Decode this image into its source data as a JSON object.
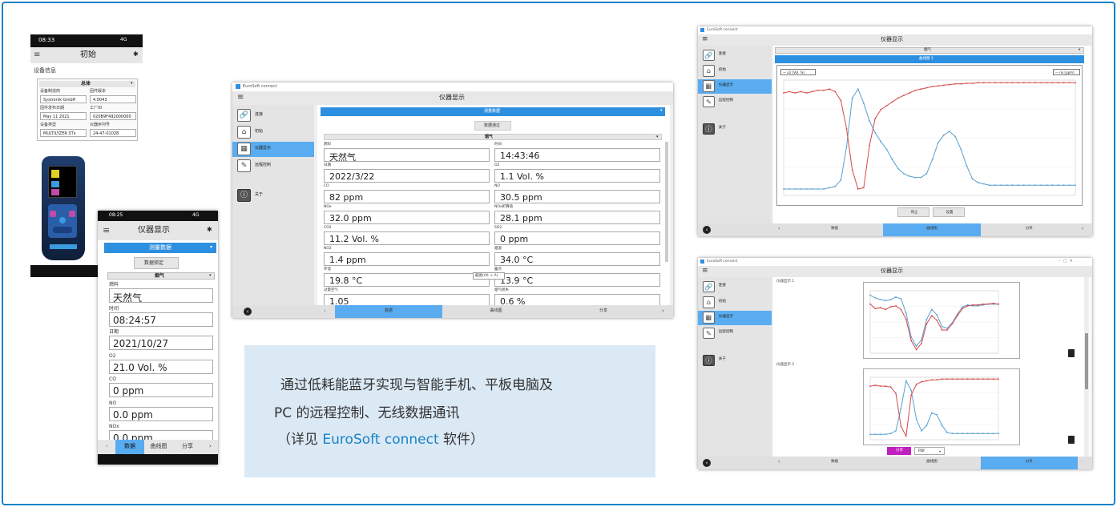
{
  "phone1": {
    "status_time": "08:33",
    "status_right": "4G",
    "title": "初始",
    "section": "设备信息",
    "group": "总体",
    "fields": [
      {
        "label": "设备制造商",
        "value": "Systronik GmbH"
      },
      {
        "label": "固件版本",
        "value": "4.0043"
      },
      {
        "label": "固件发布日期",
        "value": "May 11 2021"
      },
      {
        "label": "工厂ID",
        "value": "020B9F492000000"
      },
      {
        "label": "设备类型",
        "value": "MULTILYZER STx"
      },
      {
        "label": "仪器序列号",
        "value": "24-47-01028"
      }
    ]
  },
  "phone2": {
    "status_time": "08:25",
    "status_right": "4G",
    "title": "仪器显示",
    "subheader": "测量数据",
    "lock_button": "数据锁定",
    "group": "烟气",
    "fields": [
      {
        "label": "燃料",
        "value": "天然气"
      },
      {
        "label": "时间",
        "value": "08:24:57"
      },
      {
        "label": "日期",
        "value": "2021/10/27"
      },
      {
        "label": "O2",
        "value": "21.0 Vol. %"
      },
      {
        "label": "CO",
        "value": "0 ppm"
      },
      {
        "label": "NO",
        "value": "0.0 ppm"
      },
      {
        "label": "NOx",
        "value": "0.0 ppm"
      }
    ],
    "tabs": [
      "数据",
      "曲线图",
      "分享"
    ],
    "active_tab": 0
  },
  "win1": {
    "app": "EuroSoft connect",
    "title": "仪器显示",
    "sidebar": [
      "连接",
      "初始",
      "仪器显示",
      "远程控制",
      "关于"
    ],
    "subheader": "测量数据",
    "button": "数据通过",
    "group": "烟气",
    "fields": [
      {
        "label": "燃料",
        "value": "天然气"
      },
      {
        "label": "时间",
        "value": "14:43:46"
      },
      {
        "label": "日期",
        "value": "2022/3/22"
      },
      {
        "label": "O2",
        "value": "1.1 Vol. %"
      },
      {
        "label": "CO",
        "value": "82 ppm"
      },
      {
        "label": "NO",
        "value": "30.5 ppm"
      },
      {
        "label": "NOx",
        "value": "32.0 ppm"
      },
      {
        "label": "NOx折算值",
        "value": "28.1 ppm"
      },
      {
        "label": "CO2",
        "value": "11.2 Vol. %"
      },
      {
        "label": "SO2",
        "value": "0 ppm"
      },
      {
        "label": "NO2",
        "value": "1.4 ppm"
      },
      {
        "label": "烟温",
        "value": "34.0 °C"
      },
      {
        "label": "环温",
        "value": "19.8 °C"
      },
      {
        "label": "露点",
        "value": "13.9 °C"
      },
      {
        "label": "过量空气",
        "value": "1.05"
      },
      {
        "label": "烟气损失",
        "value": "0.6 %"
      }
    ],
    "tooltip": "截图(Alt + A)",
    "tabs": [
      "数据",
      "曲线图",
      "分享"
    ],
    "active_tab": 0
  },
  "info": {
    "line1": "通过低耗能蓝牙实现与智能手机、平板电脑及",
    "line2": "PC 的远程控制、无线数据通讯",
    "line3_pre": "（详见 ",
    "line3_link": "EuroSoft connect",
    "line3_post": " 软件）",
    "link_color": "#1a82c4",
    "bg": "#dbe9f5"
  },
  "win2": {
    "app": "EuroSoft connect",
    "title": "仪器显示",
    "sidebar": [
      "连接",
      "初始",
      "仪器显示",
      "远程控制",
      "关于"
    ],
    "dropdown": "烟气",
    "chart_title": "曲线图 1",
    "legend_left": "— o2 [Vol. %]",
    "legend_right": "— no [ppm]",
    "buttons": [
      "停止",
      "设置"
    ],
    "tabs": [
      "数据",
      "曲线图",
      "分享"
    ],
    "active_tab": 1
  },
  "win3": {
    "app": "EuroSoft connect",
    "title": "仪器显示",
    "sidebar": [
      "连接",
      "初始",
      "仪器显示",
      "远程控制",
      "关于"
    ],
    "chart1_label": "仪器显示 1",
    "chart2_label": "仪器显示 2",
    "share_button": "分享",
    "format": "PDF",
    "tabs": [
      "数据",
      "曲线图",
      "分享"
    ],
    "active_tab": 2
  },
  "chart_data": [
    {
      "type": "line",
      "title": "曲线图 1",
      "series": [
        {
          "name": "o2 [Vol. %]",
          "color": "#5aa0d0",
          "values": [
            0.5,
            0.5,
            0.5,
            0.5,
            0.5,
            0.5,
            0.5,
            0.5,
            0.6,
            0.7,
            1.2,
            3.8,
            7.6,
            8.3,
            7.2,
            5.8,
            4.9,
            4.2,
            3.6,
            2.8,
            2.1,
            1.7,
            1.5,
            1.4,
            1.4,
            1.7,
            2.8,
            4.1,
            4.7,
            5.0,
            4.6,
            3.6,
            2.3,
            1.3,
            1.0,
            0.9,
            0.8,
            0.8,
            0.8,
            0.8,
            0.8,
            0.8,
            0.8,
            0.8,
            0.8,
            0.8,
            0.8,
            0.8,
            0.8,
            0.8,
            0.8,
            0.8
          ]
        },
        {
          "name": "no [ppm]",
          "color": "#d24a4a",
          "values": [
            8.0,
            8.1,
            8.0,
            8.1,
            8.0,
            8.1,
            8.2,
            8.2,
            8.3,
            8.1,
            7.4,
            5.2,
            2.0,
            0.5,
            0.6,
            3.9,
            6.0,
            6.7,
            7.0,
            7.3,
            7.6,
            7.8,
            8.0,
            8.2,
            8.3,
            8.4,
            8.5,
            8.55,
            8.6,
            8.65,
            8.7,
            8.7,
            8.75,
            8.75,
            8.8,
            8.8,
            8.8,
            8.8,
            8.8,
            8.8,
            8.8,
            8.8,
            8.8,
            8.8,
            8.8,
            8.8,
            8.8,
            8.8,
            8.8,
            8.8,
            8.8,
            8.8
          ]
        }
      ],
      "ylim": [
        0,
        9
      ]
    },
    {
      "type": "line",
      "title": "仪器显示 1",
      "series": [
        {
          "name": "o2",
          "color": "#5aa0d0",
          "values": [
            6.5,
            6.2,
            6.0,
            5.9,
            6.0,
            6.3,
            6.1,
            4.5,
            1.8,
            0.8,
            1.5,
            3.8,
            4.9,
            4.3,
            3.0,
            2.8,
            3.4,
            4.4,
            5.2,
            5.4,
            5.3,
            5.3,
            5.4,
            5.5,
            5.5,
            5.5
          ]
        },
        {
          "name": "no",
          "color": "#d24a4a",
          "values": [
            5.5,
            5.0,
            5.1,
            4.9,
            5.2,
            5.3,
            4.9,
            3.8,
            1.4,
            0.4,
            1.1,
            3.3,
            4.2,
            3.7,
            2.6,
            2.6,
            3.3,
            4.2,
            5.0,
            5.3,
            5.4,
            5.4,
            5.5,
            5.5,
            5.6,
            5.5
          ]
        }
      ],
      "ylim": [
        0,
        7
      ]
    },
    {
      "type": "line",
      "title": "仪器显示 2",
      "series": [
        {
          "name": "o2",
          "color": "#5aa0d0",
          "values": [
            0.6,
            0.6,
            0.6,
            0.6,
            0.7,
            1.0,
            3.5,
            6.6,
            5.5,
            2.3,
            1.0,
            1.6,
            3.0,
            2.8,
            1.6,
            0.8,
            0.7,
            0.7,
            0.7,
            0.7,
            0.7,
            0.7,
            0.7,
            0.7,
            0.7,
            0.7
          ]
        },
        {
          "name": "no",
          "color": "#d24a4a",
          "values": [
            6.0,
            6.1,
            6.0,
            6.0,
            5.9,
            5.2,
            1.5,
            0.4,
            5.0,
            6.2,
            6.5,
            6.6,
            6.7,
            6.7,
            6.8,
            6.8,
            6.8,
            6.8,
            6.8,
            6.8,
            6.8,
            6.8,
            6.8,
            6.8,
            6.8,
            6.8
          ]
        }
      ],
      "ylim": [
        0,
        7
      ]
    }
  ]
}
